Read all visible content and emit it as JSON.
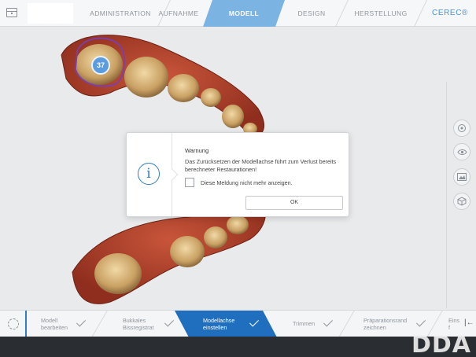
{
  "header": {
    "tabs": [
      {
        "label": "ADMINISTRATION"
      },
      {
        "label": "AUFNAHME"
      },
      {
        "label": "MODELL"
      },
      {
        "label": "DESIGN"
      },
      {
        "label": "HERSTELLUNG"
      }
    ],
    "active_tab": "MODELL",
    "brand": "CEREC®"
  },
  "model": {
    "tooth_badge": "37"
  },
  "dialog": {
    "title": "Warnung",
    "message": "Das Zurücksetzen der Modellachse führt zum Verlust bereits berechneter Restaurationen!",
    "checkbox_label": "Diese Meldung nicht mehr anzeigen.",
    "checkbox_checked": false,
    "ok_label": "OK"
  },
  "sidebar": {
    "buttons": [
      {
        "icon": "tooth-view-icon"
      },
      {
        "icon": "eye-icon"
      },
      {
        "icon": "image-icon"
      },
      {
        "icon": "cube-icon"
      }
    ]
  },
  "workflow": {
    "steps": [
      {
        "label_line1": "Modell",
        "label_line2": "bearbeiten"
      },
      {
        "label_line1": "Bukkales",
        "label_line2": "Bissregistrat"
      },
      {
        "label_line1": "Modellachse",
        "label_line2": "einstellen"
      },
      {
        "label_line1": "Trimmen",
        "label_line2": ""
      },
      {
        "label_line1": "Präparationsrand",
        "label_line2": "zeichnen"
      },
      {
        "label_line1": "Eins",
        "label_line2": "f"
      }
    ],
    "active_step": "Modellachse einstellen"
  },
  "watermark": "DDA",
  "colors": {
    "accent": "#7bb3e2",
    "active_step": "#1f6fbe",
    "brand": "#4b93d6",
    "gingiva": "#b5402a",
    "tooth": "#d9b77a"
  }
}
